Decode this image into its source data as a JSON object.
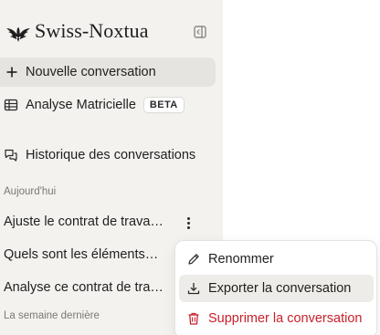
{
  "brand": {
    "name": "Swiss-Noxtua"
  },
  "sidebar": {
    "new_conversation": "Nouvelle conversation",
    "matrix_analysis": {
      "label": "Analyse Matricielle",
      "badge": "BETA"
    },
    "history": "Historique des conversations",
    "sections": [
      {
        "label": "Aujourd'hui",
        "items": [
          "Ajuste le contrat de travail…",
          "Quels sont les éléments…",
          "Analyse ce contrat de travail…"
        ]
      },
      {
        "label": "La semaine dernière",
        "items": []
      }
    ]
  },
  "context_menu": {
    "items": [
      {
        "label": "Renommer",
        "icon": "pencil-icon"
      },
      {
        "label": "Exporter la conversation",
        "icon": "download-icon"
      },
      {
        "label": "Supprimer la conversation",
        "icon": "trash-icon"
      }
    ]
  },
  "colors": {
    "sidebar_bg": "#f3f2ef",
    "selected_bg": "#e6e4e0",
    "danger": "#c8202a",
    "brand_dark": "#1e1e1e"
  }
}
